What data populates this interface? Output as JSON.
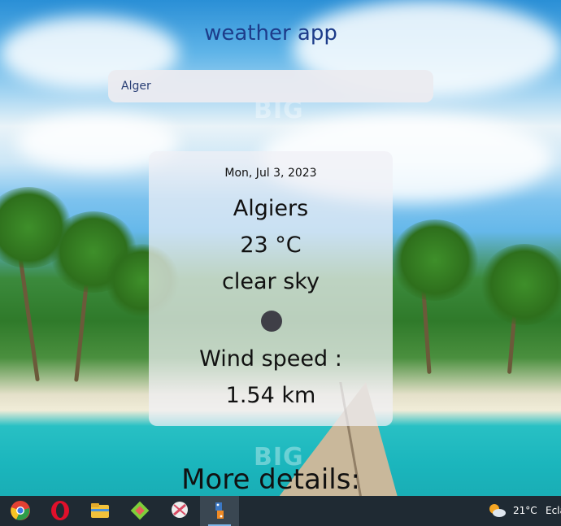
{
  "app": {
    "title": "weather app"
  },
  "search": {
    "value": "Alger"
  },
  "weather_card": {
    "date": "Mon, Jul 3, 2023",
    "city": "Algiers",
    "temperature": "23 °C",
    "description": "clear sky",
    "icon": "weather-icon",
    "wind_label": "Wind speed :",
    "wind_value": "1.54 km"
  },
  "more_details": {
    "label": "More details:"
  },
  "taskbar": {
    "apps": [
      {
        "name": "chrome-icon",
        "color": "#e34133"
      },
      {
        "name": "opera-icon",
        "color": "#e0102b"
      },
      {
        "name": "file-explorer-icon",
        "color": "#f3c23a"
      },
      {
        "name": "gitkraken-icon",
        "color": "#7fcf3a"
      },
      {
        "name": "snipping-tool-icon",
        "color": "#d94b64"
      },
      {
        "name": "python-idle-icon",
        "color": "#f08a24"
      }
    ],
    "tray": {
      "weather_icon": "sun-cloud-icon",
      "temperature": "21°C",
      "label": "Ecla"
    }
  },
  "watermark": {
    "text": "BIG"
  },
  "colors": {
    "title": "#1d3c8a",
    "card_bg": "#f0f0f5",
    "taskbar": "#1f2a33"
  }
}
